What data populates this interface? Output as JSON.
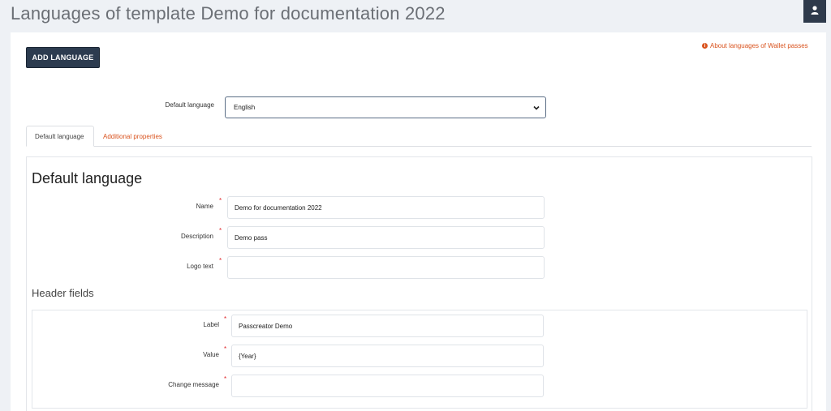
{
  "page": {
    "title": "Languages of template Demo for documentation 2022"
  },
  "toolbar": {
    "add_language_label": "ADD LANGUAGE",
    "about_link_label": "About languages of Wallet passes"
  },
  "default_language_select": {
    "label": "Default language",
    "selected": "English"
  },
  "tabs": [
    {
      "label": "Default language",
      "active": true
    },
    {
      "label": "Additional properties",
      "active": false
    }
  ],
  "section": {
    "title": "Default language",
    "fields": [
      {
        "label": "Name",
        "value": "Demo for documentation 2022",
        "required": true
      },
      {
        "label": "Description",
        "value": "Demo pass",
        "required": true
      },
      {
        "label": "Logo text",
        "value": "",
        "required": true
      }
    ]
  },
  "header_fields": {
    "title": "Header fields",
    "fields": [
      {
        "label": "Label",
        "value": "Passcreator Demo",
        "required": true
      },
      {
        "label": "Value",
        "value": "{Year}",
        "required": true
      },
      {
        "label": "Change message",
        "value": "",
        "required": true
      }
    ]
  },
  "colors": {
    "accent": "#d9531e",
    "button_bg": "#2c3b4f",
    "required": "#e0262a"
  },
  "icons": {
    "user": "user-icon",
    "info": "info-icon",
    "chevron": "chevron-down-icon"
  }
}
